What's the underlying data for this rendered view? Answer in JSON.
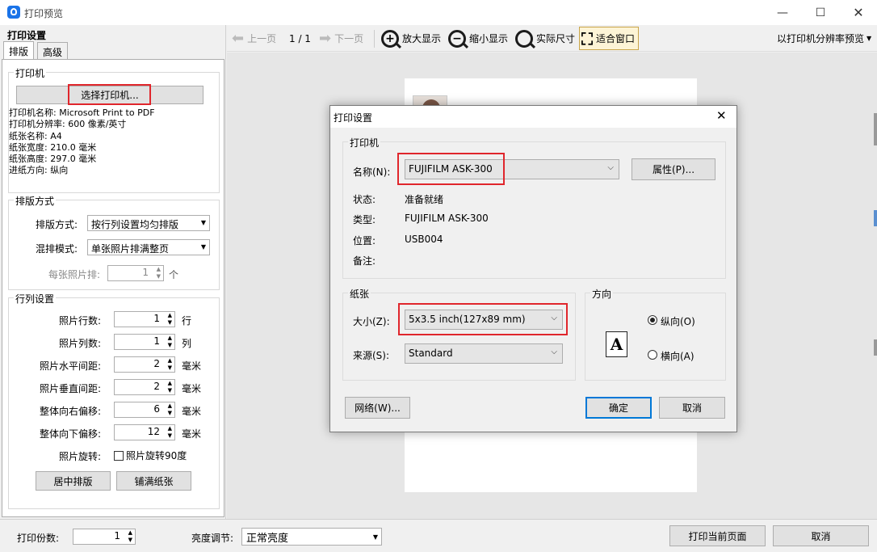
{
  "window": {
    "title": "打印预览",
    "icon": "app-logo-icon"
  },
  "left_panel": {
    "title": "打印设置",
    "tabs": [
      "排版",
      "高级"
    ],
    "printer_group": {
      "title": "打印机",
      "select_button": "选择打印机...",
      "info": [
        "打印机名称: Microsoft Print to PDF",
        "打印机分辨率: 600 像素/英寸",
        "纸张名称: A4",
        "纸张宽度: 210.0 毫米",
        "纸张高度: 297.0 毫米",
        "进纸方向: 纵向"
      ]
    },
    "layout_group": {
      "title": "排版方式",
      "mode_label": "排版方式:",
      "mode_value": "按行列设置均匀排版",
      "mix_label": "混排模式:",
      "mix_value": "单张照片排满整页",
      "per_photo_label": "每张照片排:",
      "per_photo_value": "1",
      "per_photo_unit": "个"
    },
    "grid_group": {
      "title": "行列设置",
      "rows": [
        {
          "label": "照片行数:",
          "value": "1",
          "unit": "行"
        },
        {
          "label": "照片列数:",
          "value": "1",
          "unit": "列"
        },
        {
          "label": "照片水平间距:",
          "value": "2",
          "unit": "毫米"
        },
        {
          "label": "照片垂直间距:",
          "value": "2",
          "unit": "毫米"
        },
        {
          "label": "整体向右偏移:",
          "value": "6",
          "unit": "毫米"
        },
        {
          "label": "整体向下偏移:",
          "value": "12",
          "unit": "毫米"
        }
      ],
      "rotate_label": "照片旋转:",
      "rotate_checkbox": "照片旋转90度",
      "center_button": "居中排版",
      "fill_button": "铺满纸张"
    }
  },
  "toolbar": {
    "prev": "上一页",
    "page": "1 / 1",
    "next": "下一页",
    "zoom_in": "放大显示",
    "zoom_out": "缩小显示",
    "actual": "实际尺寸",
    "fit": "适合窗口",
    "resolution": "以打印机分辨率预览"
  },
  "dialog": {
    "title": "打印设置",
    "printer_group_title": "打印机",
    "name_label": "名称(N):",
    "name_value": "FUJIFILM ASK-300",
    "properties_button": "属性(P)...",
    "status_label": "状态:",
    "status_value": "准备就绪",
    "type_label": "类型:",
    "type_value": "FUJIFILM ASK-300",
    "location_label": "位置:",
    "location_value": "USB004",
    "comment_label": "备注:",
    "paper_group_title": "纸张",
    "size_label": "大小(Z):",
    "size_value": "5x3.5 inch(127x89 mm)",
    "source_label": "来源(S):",
    "source_value": "Standard",
    "orientation_group_title": "方向",
    "portrait": "纵向(O)",
    "landscape": "横向(A)",
    "orientation_selected": "portrait",
    "network_button": "网络(W)...",
    "ok_button": "确定",
    "cancel_button": "取消"
  },
  "bottom": {
    "copies_label": "打印份数:",
    "copies_value": "1",
    "brightness_label": "亮度调节:",
    "brightness_value": "正常亮度",
    "print_button": "打印当前页面",
    "cancel_button": "取消"
  },
  "colors": {
    "accent": "#1a73e8",
    "highlight": "#e0262c",
    "default_button_border": "#0078d7"
  }
}
